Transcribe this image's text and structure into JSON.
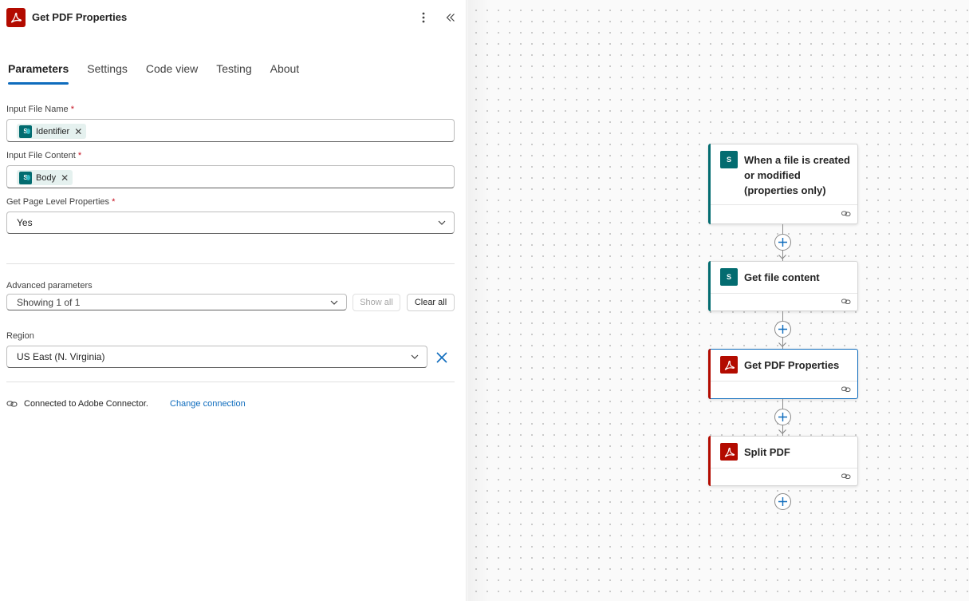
{
  "panel": {
    "title": "Get PDF Properties",
    "icons": {
      "logo": "adobe-pdf-icon",
      "more": "more-vertical-icon",
      "collapse": "chevron-double-left-icon"
    },
    "tabs": [
      {
        "label": "Parameters",
        "active": true
      },
      {
        "label": "Settings",
        "active": false
      },
      {
        "label": "Code view",
        "active": false
      },
      {
        "label": "Testing",
        "active": false
      },
      {
        "label": "About",
        "active": false
      }
    ],
    "fields": {
      "input_file_name": {
        "label": "Input File Name",
        "required_mark": "*",
        "token": "Identifier"
      },
      "input_file_content": {
        "label": "Input File Content",
        "required_mark": "*",
        "token": "Body"
      },
      "page_level": {
        "label": "Get Page Level Properties",
        "required_mark": "*",
        "value": "Yes"
      }
    },
    "advanced": {
      "label": "Advanced parameters",
      "showing": "Showing 1 of 1",
      "show_all": "Show all",
      "clear_all": "Clear all"
    },
    "region": {
      "label": "Region",
      "value": "US East (N. Virginia)"
    },
    "connection": {
      "text": "Connected to Adobe Connector.",
      "change_link": "Change connection"
    }
  },
  "canvas": {
    "nodes": [
      {
        "title": "When a file is created or modified (properties only)",
        "icon": "sharepoint-icon",
        "accent": "#036c70"
      },
      {
        "title": "Get file content",
        "icon": "sharepoint-icon",
        "accent": "#036c70"
      },
      {
        "title": "Get PDF Properties",
        "icon": "adobe-pdf-icon",
        "accent": "#b30b00",
        "selected": true
      },
      {
        "title": "Split PDF",
        "icon": "adobe-pdf-icon",
        "accent": "#b30b00"
      }
    ]
  },
  "colors": {
    "accent_blue": "#0f6cbd",
    "adobe_red": "#b30b00",
    "sharepoint_teal": "#036c70",
    "required_red": "#c50f1f"
  }
}
